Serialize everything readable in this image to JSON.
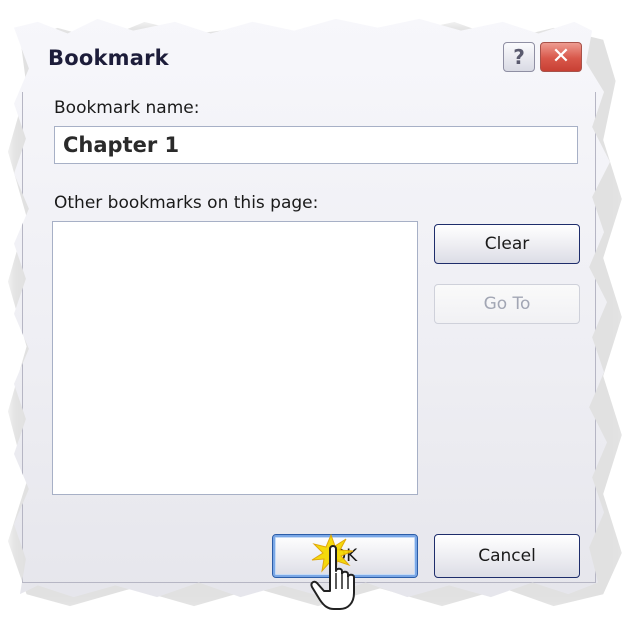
{
  "dialog": {
    "title": "Bookmark",
    "help_label": "?",
    "close_label": "✕"
  },
  "form": {
    "name_label": "Bookmark name:",
    "name_value": "Chapter 1",
    "others_label": "Other bookmarks on this page:",
    "others_items": []
  },
  "buttons": {
    "clear": "Clear",
    "goto": "Go To",
    "ok": "OK",
    "cancel": "Cancel"
  },
  "cursor": {
    "icon": "hand-pointer-icon",
    "highlight_color": "#f5d800"
  }
}
